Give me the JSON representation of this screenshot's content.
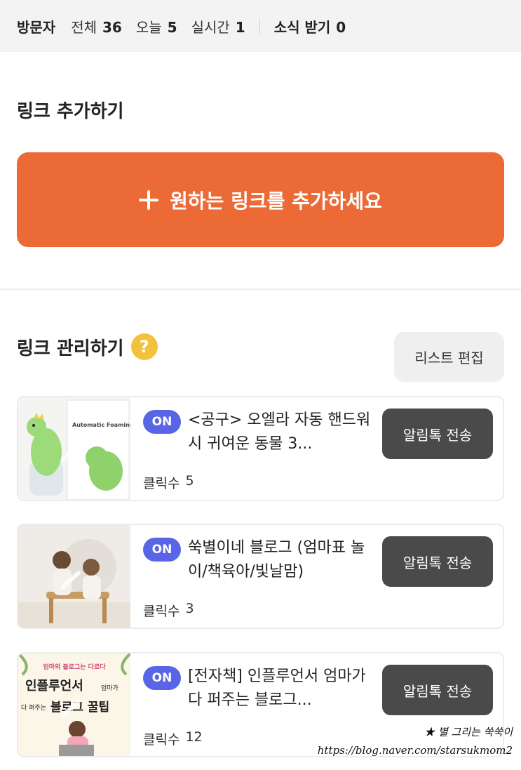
{
  "stats": {
    "title": "방문자",
    "total_label": "전체",
    "total_value": "36",
    "today_label": "오늘",
    "today_value": "5",
    "realtime_label": "실시간",
    "realtime_value": "1",
    "subscribe_label": "소식 받기",
    "subscribe_value": "0"
  },
  "add_section": {
    "title": "링크 추가하기",
    "button_label": "원하는 링크를 추가하세요",
    "button_color": "#ec6a36"
  },
  "manage_section": {
    "title": "링크 관리하기",
    "help_icon": "?",
    "edit_button": "리스트 편집"
  },
  "links": [
    {
      "status": "ON",
      "title": "<공구> 오엘라 자동 핸드워시 귀여운 동물 3...",
      "click_label": "클릭수",
      "click_count": "5",
      "send_label": "알림톡 전송",
      "thumb": {
        "icon": "dinosaur-soap-dispenser",
        "box_text": "Automatic Foaming Soap Dispenser"
      }
    },
    {
      "status": "ON",
      "title": "쑥별이네 블로그 (엄마표 놀이/책육아/빛날맘)",
      "click_label": "클릭수",
      "click_count": "3",
      "send_label": "알림톡 전송",
      "thumb": {
        "icon": "children-photo"
      }
    },
    {
      "status": "ON",
      "title": "[전자책] 인플루언서 엄마가 다 퍼주는 블로그...",
      "click_label": "클릭수",
      "click_count": "12",
      "send_label": "알림톡 전송",
      "thumb": {
        "icon": "ebook-cover",
        "line1": "엄마의 블로그는 다르다",
        "line2": "인플루언서",
        "line2b": "엄마가",
        "line3a": "다 퍼주는",
        "line3b": "블로그 꿀팁"
      }
    }
  ],
  "watermark": {
    "line1": "★ 별 그리는 쑥쑥이",
    "line2": "https://blog.naver.com/starsukmom2"
  },
  "colors": {
    "on_badge": "#5865e6",
    "send_button": "#4a4a4a",
    "help_icon": "#f4c13d"
  }
}
